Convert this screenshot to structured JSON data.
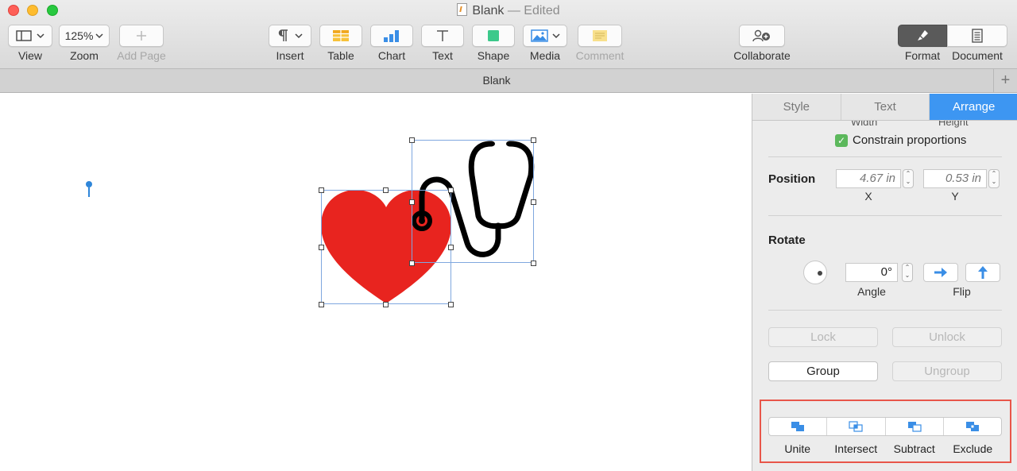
{
  "window": {
    "title": "Blank",
    "edited": "— Edited"
  },
  "toolbar": {
    "view": {
      "label": "View"
    },
    "zoom": {
      "value": "125%",
      "label": "Zoom"
    },
    "add_page": {
      "label": "Add Page"
    },
    "insert": {
      "label": "Insert"
    },
    "table": {
      "label": "Table"
    },
    "chart": {
      "label": "Chart"
    },
    "text": {
      "label": "Text"
    },
    "shape": {
      "label": "Shape"
    },
    "media": {
      "label": "Media"
    },
    "comment": {
      "label": "Comment"
    },
    "collaborate": {
      "label": "Collaborate"
    },
    "format": {
      "label": "Format"
    },
    "document": {
      "label": "Document"
    }
  },
  "tabbar": {
    "title": "Blank",
    "add": "+"
  },
  "inspector": {
    "tabs": [
      {
        "label": "Style"
      },
      {
        "label": "Text"
      },
      {
        "label": "Arrange"
      }
    ],
    "size": {
      "width_label": "Width",
      "height_label": "Height"
    },
    "constrain": {
      "label": "Constrain proportions",
      "checked": true
    },
    "position": {
      "label": "Position",
      "x": {
        "value": "4.67 in",
        "label": "X"
      },
      "y": {
        "value": "0.53 in",
        "label": "Y"
      }
    },
    "rotate": {
      "label": "Rotate",
      "angle": {
        "value": "0°",
        "label": "Angle"
      },
      "flip_label": "Flip"
    },
    "lock": {
      "label": "Lock"
    },
    "unlock": {
      "label": "Unlock"
    },
    "group": {
      "label": "Group"
    },
    "ungroup": {
      "label": "Ungroup"
    },
    "boolean_ops": [
      {
        "label": "Unite"
      },
      {
        "label": "Intersect"
      },
      {
        "label": "Subtract"
      },
      {
        "label": "Exclude"
      }
    ]
  },
  "colors": {
    "accent": "#3d96f2",
    "heart": "#e8241f",
    "highlight": "#e8564a",
    "selection": "#7fa7df"
  }
}
